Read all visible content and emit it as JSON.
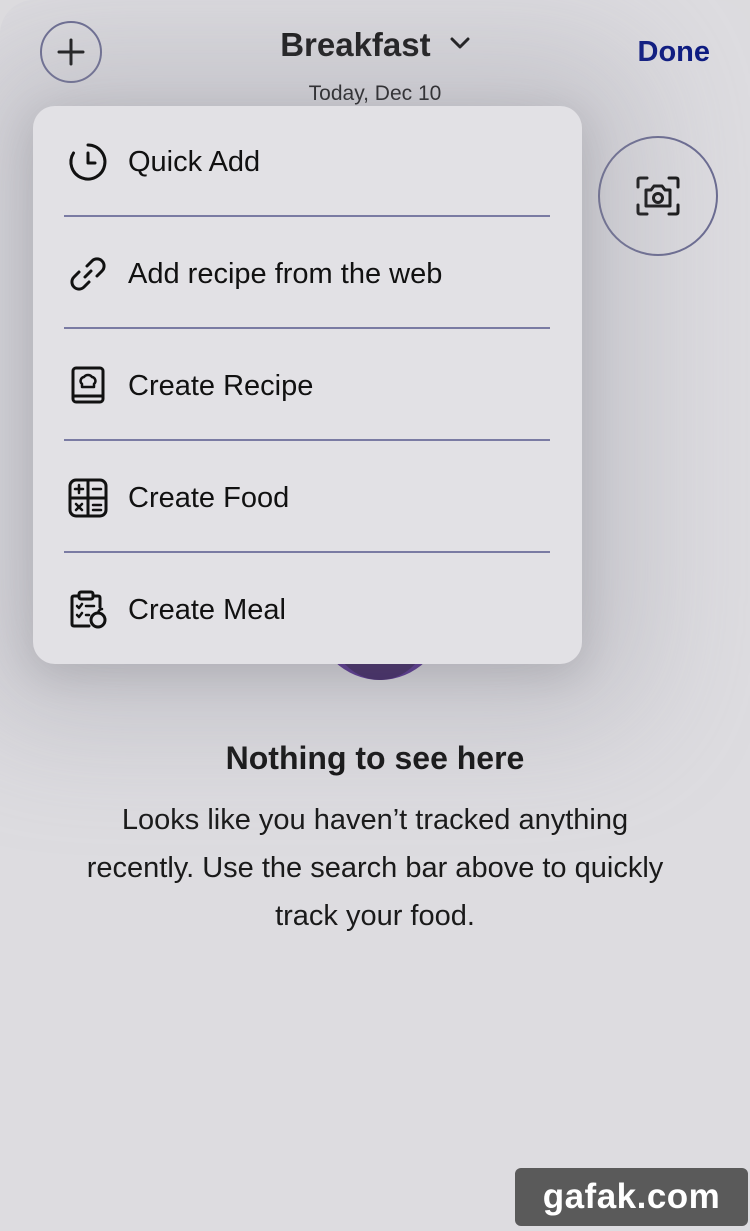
{
  "header": {
    "add_icon": "plus-icon",
    "title": "Breakfast",
    "title_icon": "chevron-down-icon",
    "date": "Today, Dec 10",
    "done_label": "Done"
  },
  "camera": {
    "icon": "camera-scan-icon"
  },
  "menu": {
    "items": [
      {
        "label": "Quick Add",
        "icon": "timer-icon"
      },
      {
        "label": "Add recipe from the web",
        "icon": "link-icon"
      },
      {
        "label": "Create Recipe",
        "icon": "recipe-book-icon"
      },
      {
        "label": "Create Food",
        "icon": "calculator-grid-icon"
      },
      {
        "label": "Create Meal",
        "icon": "clipboard-apple-icon"
      }
    ]
  },
  "empty_state": {
    "title": "Nothing to see here",
    "body": "Looks like you haven’t tracked anything recently. Use the search bar above to quickly track your food."
  },
  "watermark": {
    "text": "gafak.com"
  },
  "colors": {
    "accent": "#0b1980",
    "outline": "#6a6b91",
    "background": "#dddce0",
    "menu_background": "#e2e1e5"
  }
}
